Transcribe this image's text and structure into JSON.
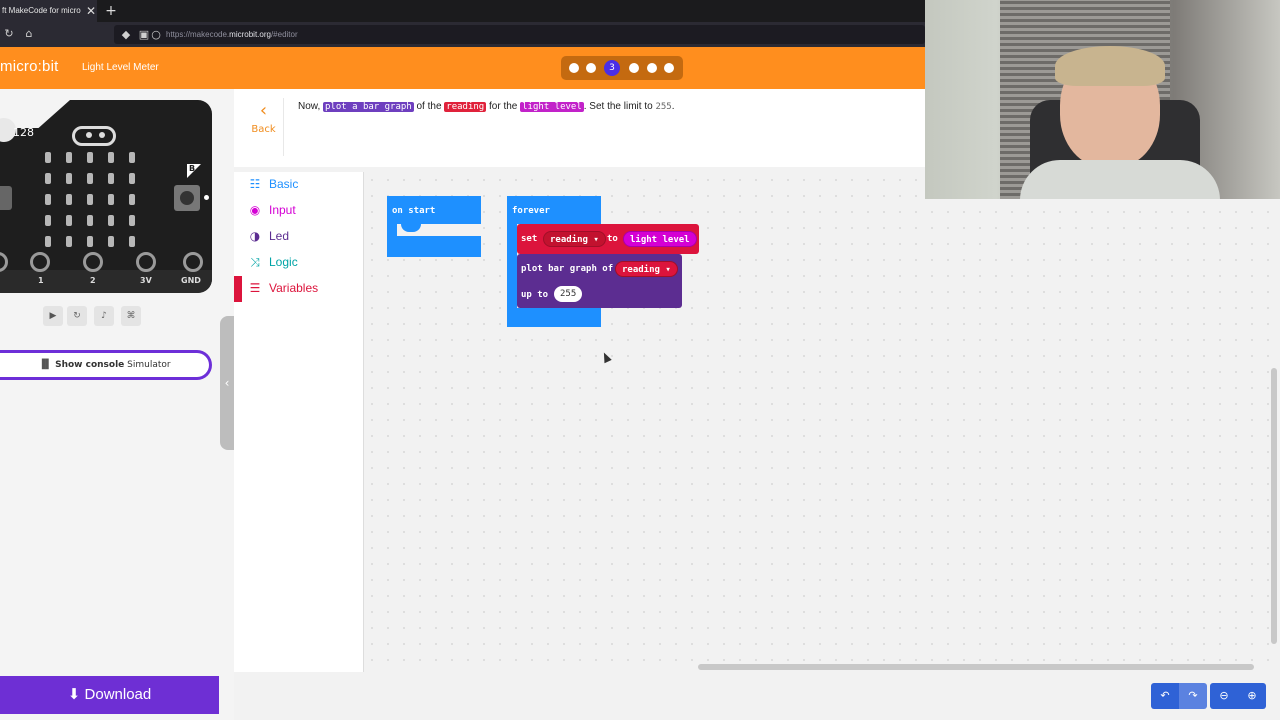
{
  "browser": {
    "tab_title": "ft MakeCode for micro",
    "tab_close": "✕",
    "new_tab": "+",
    "url_prefix": "https://makecode.",
    "url_domain": "microbit.org",
    "url_suffix": "/#editor"
  },
  "header": {
    "logo": "micro:bit",
    "project_name": "Light Level Meter",
    "current_step": "3"
  },
  "simulator": {
    "display_value": "128",
    "button_b_label": "B",
    "pins": [
      "1",
      "2",
      "3V",
      "GND"
    ],
    "show_console_label": "Show console",
    "show_console_suffix": "Simulator",
    "download_label": "Download"
  },
  "hint": {
    "back_label": "Back",
    "text_1": "Now, ",
    "code_1": "plot a bar graph",
    "text_2": " of the ",
    "code_2": "reading",
    "text_3": " for the ",
    "code_3": "light level",
    "text_4": ". Set the limit to ",
    "code_4": "255",
    "text_5": "."
  },
  "toolbox": {
    "items": [
      {
        "label": "Basic",
        "color": "#1e90ff",
        "icon": "grid-icon"
      },
      {
        "label": "Input",
        "color": "#d400d4",
        "icon": "target-icon"
      },
      {
        "label": "Led",
        "color": "#5c2d91",
        "icon": "toggle-icon"
      },
      {
        "label": "Logic",
        "color": "#00a4a6",
        "icon": "shuffle-icon"
      },
      {
        "label": "Variables",
        "color": "#dc143c",
        "icon": "list-icon"
      }
    ]
  },
  "workspace": {
    "on_start_label": "on start",
    "forever_label": "forever",
    "set_label": "set",
    "variable_name": "reading",
    "to_label": "to",
    "light_level_label": "light level",
    "plot_label": "plot bar graph of",
    "up_to_label": "up to",
    "limit_value": "255"
  }
}
